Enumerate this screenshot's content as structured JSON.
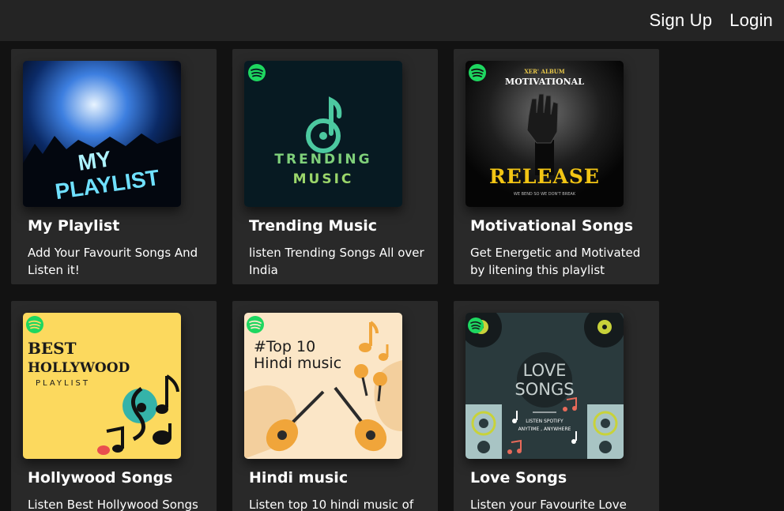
{
  "header": {
    "signup_label": "Sign Up",
    "login_label": "Login"
  },
  "cards": [
    {
      "title": "My Playlist",
      "description": "Add Your Favourit Songs And Listen it!",
      "art_text": [
        "MY",
        "PLAYLIST"
      ]
    },
    {
      "title": "Trending Music",
      "description": "listen Trending Songs All over India",
      "art_text": [
        "TRENDING",
        "MUSIC"
      ]
    },
    {
      "title": "Motivational Songs",
      "description": "Get Energetic and Motivated by litening this playlist",
      "art_text": [
        "XER' ALBUM",
        "MOTIVATIONAL",
        "RELEASE",
        "WE BEND SO WE DON'T BREAK"
      ]
    },
    {
      "title": "Hollywood Songs",
      "description": "Listen Best Hollywood Songs",
      "art_text": [
        "BEST",
        "HOLLYWOOD",
        "PLAYLIST"
      ]
    },
    {
      "title": "Hindi music",
      "description": "Listen top 10 hindi music of",
      "art_text": [
        "#Top 10",
        "Hindi music"
      ]
    },
    {
      "title": "Love Songs",
      "description": "Listen your Favourite Love",
      "art_text": [
        "LOVE",
        "SONGS",
        "LISTEN SPOTIFY",
        "ANYTIME , ANYWHERE"
      ]
    }
  ],
  "colors": {
    "page_bg": "#121212",
    "header_bg": "#242424",
    "card_bg": "#292929",
    "spotify_green": "#1ed760"
  }
}
